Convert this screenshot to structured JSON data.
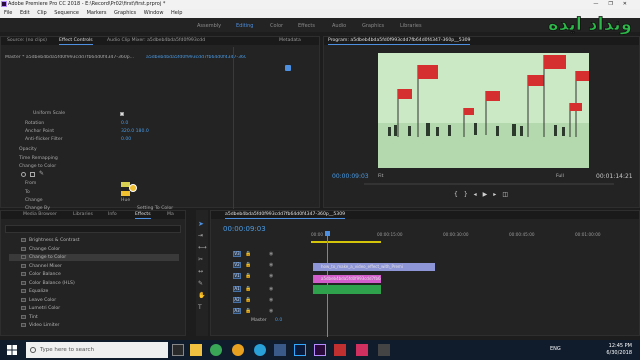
{
  "window": {
    "title": "Adobe Premiere Pro CC 2018 - E:\\Record\\Pr02\\first\\first.prproj *",
    "controls": [
      "—",
      "❐",
      "✕"
    ]
  },
  "menu": [
    "File",
    "Edit",
    "Clip",
    "Sequence",
    "Markers",
    "Graphics",
    "Window",
    "Help"
  ],
  "workspaces": [
    "Assembly",
    "Editing",
    "Color",
    "Effects",
    "Audio",
    "Graphics",
    "Libraries"
  ],
  "logo": {
    "text": "ونداد ایده"
  },
  "effect_controls": {
    "tabs": [
      "Source: (no clips)",
      "Effect Controls",
      "Audio Clip Mixer: a5dbeb4bda5fd0f993cdd",
      "Metadata"
    ],
    "master": "Master * a5dbeb4bda5fd0f993cdd7fb64d0f4347-360p...",
    "clip": "a5dbeb4bda5fd0f993cdd7fb64d0f4347-360p_5309...",
    "rows": [
      {
        "label": "Uniform Scale",
        "value": ""
      },
      {
        "label": "Rotation",
        "value": "0.0"
      },
      {
        "label": "Anchor Point",
        "value": "320.0    180.0"
      },
      {
        "label": "Anti-flicker Filter",
        "value": "0.00"
      },
      {
        "label": "Opacity",
        "value": ""
      },
      {
        "label": "Time Remapping",
        "value": ""
      },
      {
        "label": "Change to Color",
        "value": ""
      },
      {
        "label": "From",
        "value": ""
      },
      {
        "label": "To",
        "value": ""
      },
      {
        "label": "Change",
        "value": "Hue"
      },
      {
        "label": "Change By",
        "value": "Setting To Color"
      },
      {
        "label": "Tolerance",
        "value": ""
      },
      {
        "label": "Hue",
        "value": "10.0 %"
      },
      {
        "label": "Softness",
        "value": "0.0 %"
      }
    ],
    "from_color": "#d8d050",
    "to_color": "#f0c030",
    "timecode": "00:00:09:03"
  },
  "program": {
    "title": "Program: a5dbeb4bda5fd0f993cdd7fb64d0f4347-360p__5309",
    "timecode": "00:00:09:03",
    "fit": "Fit",
    "full": "Full",
    "duration": "00:01:14:21"
  },
  "browser": {
    "tabs": [
      "Media Browser",
      "Libraries",
      "Info",
      "Effects",
      "Ma"
    ],
    "items": [
      "Brightness & Contrast",
      "Change Color",
      "Change to Color",
      "Channel Mixer",
      "Color Balance",
      "Color Balance (HLS)",
      "Equalize",
      "Leave Color",
      "Lumetri Color",
      "Tint",
      "Video Limiter"
    ],
    "selected_index": 2
  },
  "timeline": {
    "tab": "a5dbeb4bda5fd0f993cdd7fb64d0f4347-360p__5309",
    "timecode": "00:00:09:03",
    "ruler": [
      "00:00",
      "00:00:15:00",
      "00:00:30:00",
      "00:00:45:00",
      "00:01:00:00",
      "00:01:15:00"
    ],
    "tracks": [
      "V3",
      "V2",
      "V1",
      "A1",
      "A2",
      "A3"
    ],
    "master": "Master",
    "master_val": "0.0",
    "clip_v2": "how_to_make_a_video_effect_with_Premi",
    "clip_v1": "a5dbeb4bda5fd0f993cdd7fb64d0f4347-360p"
  },
  "taskbar": {
    "search": "Type here to search",
    "time": "12:45 PM",
    "date": "6/30/2018",
    "lang": "ENG"
  }
}
